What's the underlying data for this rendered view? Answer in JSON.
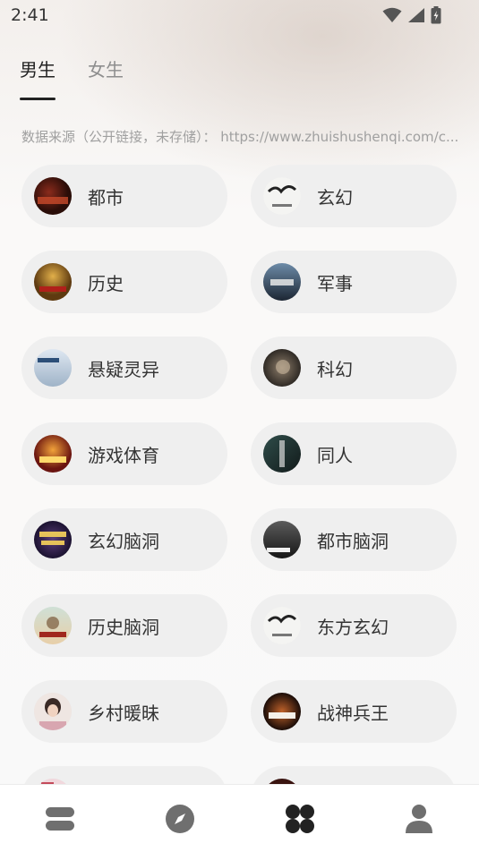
{
  "status_bar": {
    "time": "2:41"
  },
  "tabs": [
    {
      "label": "男生",
      "active": true
    },
    {
      "label": "女生",
      "active": false
    }
  ],
  "source_note": "数据来源（公开链接，未存储）： https://www.zhuishushenqi.com/c...",
  "categories": [
    {
      "label": "都市",
      "cover": "cover-dark-red"
    },
    {
      "label": "玄幻",
      "cover": "cover-ink-white"
    },
    {
      "label": "历史",
      "cover": "cover-gold"
    },
    {
      "label": "军事",
      "cover": "cover-blue-grey"
    },
    {
      "label": "悬疑灵异",
      "cover": "cover-pale-blue"
    },
    {
      "label": "科幻",
      "cover": "cover-grey-brown"
    },
    {
      "label": "游戏体育",
      "cover": "cover-orange-red"
    },
    {
      "label": "同人",
      "cover": "cover-dark-teal"
    },
    {
      "label": "玄幻脑洞",
      "cover": "cover-purple-gold"
    },
    {
      "label": "都市脑洞",
      "cover": "cover-dark-grey"
    },
    {
      "label": "历史脑洞",
      "cover": "cover-pastel"
    },
    {
      "label": "东方玄幻",
      "cover": "cover-ink-white"
    },
    {
      "label": "乡村暖昧",
      "cover": "cover-portrait"
    },
    {
      "label": "战神兵王",
      "cover": "cover-fiery"
    },
    {
      "label": "",
      "cover": "cover-pink"
    },
    {
      "label": "",
      "cover": "cover-dark-red"
    }
  ],
  "bottom_nav": [
    {
      "icon": "bookshelf-icon",
      "active": false
    },
    {
      "icon": "compass-icon",
      "active": false
    },
    {
      "icon": "categories-icon",
      "active": true
    },
    {
      "icon": "profile-icon",
      "active": false
    }
  ],
  "colors": {
    "accent": "#222222",
    "inactive_tab": "#8e8e8e",
    "pill_background": "#efefef",
    "nav_icon": "#6f6f6f"
  }
}
